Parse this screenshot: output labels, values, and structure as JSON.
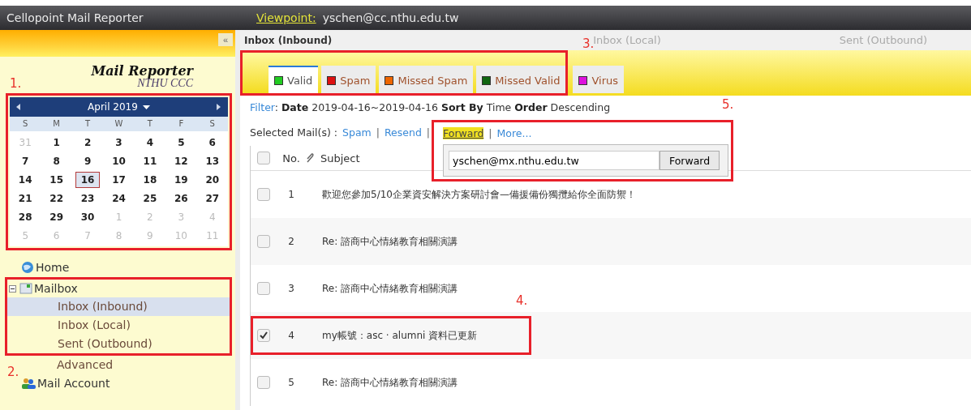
{
  "topbar": {
    "app_title": "Cellopoint Mail Reporter",
    "viewpoint_label": "Viewpoint:",
    "viewpoint_user": "yschen@cc.nthu.edu.tw"
  },
  "sidebar": {
    "collapse": "«",
    "logo_title": "Mail Reporter",
    "logo_subtitle": "NTHU CCC",
    "calendar": {
      "month": "April 2019",
      "weekdays": [
        "S",
        "M",
        "T",
        "W",
        "T",
        "F",
        "S"
      ],
      "weeks": [
        [
          {
            "d": "31",
            "other": true,
            "selected": false
          },
          {
            "d": "1",
            "other": false,
            "selected": false
          },
          {
            "d": "2",
            "other": false,
            "selected": false
          },
          {
            "d": "3",
            "other": false,
            "selected": false
          },
          {
            "d": "4",
            "other": false,
            "selected": false
          },
          {
            "d": "5",
            "other": false,
            "selected": false
          },
          {
            "d": "6",
            "other": false,
            "selected": false
          }
        ],
        [
          {
            "d": "7",
            "other": false,
            "selected": false
          },
          {
            "d": "8",
            "other": false,
            "selected": false
          },
          {
            "d": "9",
            "other": false,
            "selected": false
          },
          {
            "d": "10",
            "other": false,
            "selected": false
          },
          {
            "d": "11",
            "other": false,
            "selected": false
          },
          {
            "d": "12",
            "other": false,
            "selected": false
          },
          {
            "d": "13",
            "other": false,
            "selected": false
          }
        ],
        [
          {
            "d": "14",
            "other": false,
            "selected": false
          },
          {
            "d": "15",
            "other": false,
            "selected": false
          },
          {
            "d": "16",
            "other": false,
            "selected": true
          },
          {
            "d": "17",
            "other": false,
            "selected": false
          },
          {
            "d": "18",
            "other": false,
            "selected": false
          },
          {
            "d": "19",
            "other": false,
            "selected": false
          },
          {
            "d": "20",
            "other": false,
            "selected": false
          }
        ],
        [
          {
            "d": "21",
            "other": false,
            "selected": false
          },
          {
            "d": "22",
            "other": false,
            "selected": false
          },
          {
            "d": "23",
            "other": false,
            "selected": false
          },
          {
            "d": "24",
            "other": false,
            "selected": false
          },
          {
            "d": "25",
            "other": false,
            "selected": false
          },
          {
            "d": "26",
            "other": false,
            "selected": false
          },
          {
            "d": "27",
            "other": false,
            "selected": false
          }
        ],
        [
          {
            "d": "28",
            "other": false,
            "selected": false
          },
          {
            "d": "29",
            "other": false,
            "selected": false
          },
          {
            "d": "30",
            "other": false,
            "selected": false
          },
          {
            "d": "1",
            "other": true,
            "selected": false
          },
          {
            "d": "2",
            "other": true,
            "selected": false
          },
          {
            "d": "3",
            "other": true,
            "selected": false
          },
          {
            "d": "4",
            "other": true,
            "selected": false
          }
        ],
        [
          {
            "d": "5",
            "other": true,
            "selected": false
          },
          {
            "d": "6",
            "other": true,
            "selected": false
          },
          {
            "d": "7",
            "other": true,
            "selected": false
          },
          {
            "d": "8",
            "other": true,
            "selected": false
          },
          {
            "d": "9",
            "other": true,
            "selected": false
          },
          {
            "d": "10",
            "other": true,
            "selected": false
          },
          {
            "d": "11",
            "other": true,
            "selected": false
          }
        ]
      ]
    },
    "nav": [
      {
        "kind": "home",
        "label": "Home"
      },
      {
        "kind": "mailbox",
        "label": "Mailbox",
        "expanded": true,
        "children": [
          {
            "label": "Inbox (Inbound)",
            "selected": true
          },
          {
            "label": "Inbox (Local)",
            "selected": false
          },
          {
            "label": "Sent (Outbound)",
            "selected": false
          },
          {
            "label": "Advanced",
            "selected": false
          }
        ]
      },
      {
        "kind": "account",
        "label": "Mail Account"
      }
    ]
  },
  "main": {
    "title": "Inbox (Inbound)",
    "faded_links": [
      "Inbox (Local)",
      "Sent (Outbound)"
    ],
    "tabs": [
      {
        "label": "Valid",
        "color": "#22cc22",
        "selected": true
      },
      {
        "label": "Spam",
        "color": "#dd1111",
        "selected": false
      },
      {
        "label": "Missed Spam",
        "color": "#ee6600",
        "selected": false
      },
      {
        "label": "Missed Valid",
        "color": "#116611",
        "selected": false
      },
      {
        "label": "Virus",
        "color": "#dd11dd",
        "selected": false
      }
    ],
    "filter": {
      "label": "Filter",
      "text": ": **Date** 2019-04-16~2019-04-16 **Sort By** Time **Order** Descending"
    },
    "actions": {
      "label": "Selected Mail(s) :",
      "separator": "|",
      "links": [
        {
          "label": "Spam",
          "highlighted": false
        },
        {
          "label": "Resend",
          "highlighted": false
        },
        {
          "label": "Forward",
          "highlighted": true
        },
        {
          "label": "More...",
          "highlighted": false
        }
      ]
    },
    "forward_popup": {
      "value": "yschen@mx.nthu.edu.tw",
      "button": "Forward"
    },
    "table": {
      "columns": [
        "No.",
        "Subject"
      ],
      "select_all_checked": false,
      "rows": [
        {
          "no": "1",
          "subject": "歡迎您參加5/10企業資安解決方案研討會—備援備份獨攬給你全面防禦！",
          "checked": false
        },
        {
          "no": "2",
          "subject": "Re: 諮商中心情緒教育相關演講",
          "checked": false
        },
        {
          "no": "3",
          "subject": "Re: 諮商中心情緒教育相關演講",
          "checked": false
        },
        {
          "no": "4",
          "subject": "my帳號：asc · alumni 資料已更新",
          "checked": true
        },
        {
          "no": "5",
          "subject": "Re: 諮商中心情緒教育相關演講",
          "checked": false
        }
      ]
    }
  },
  "annotations": [
    "1.",
    "2.",
    "3.",
    "4.",
    "5."
  ]
}
